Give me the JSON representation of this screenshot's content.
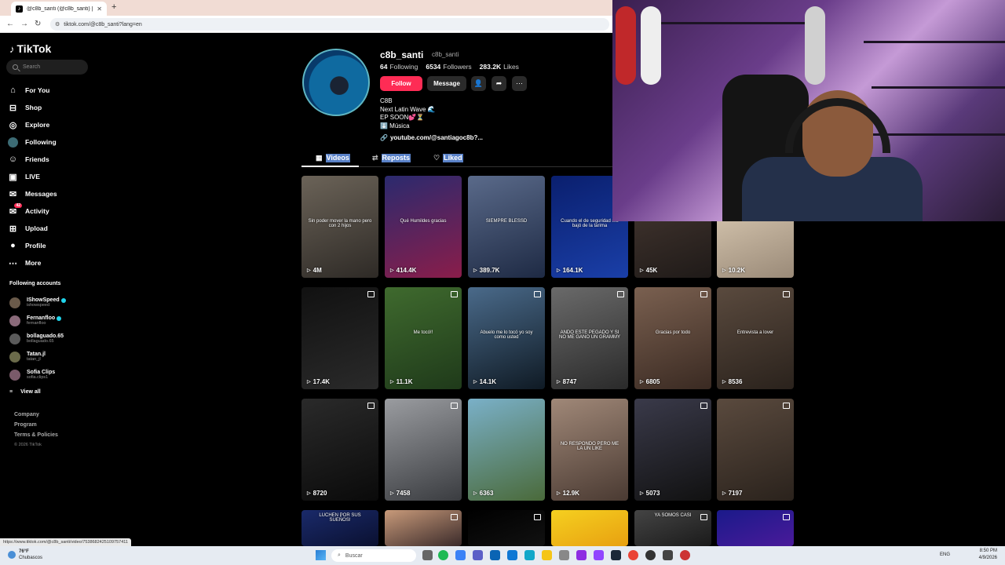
{
  "browser": {
    "tab_title": "@c8b_santi (@c8b_santi) | TikTok",
    "url": "tiktok.com/@c8b_santi?lang=en",
    "status_url": "https://www.tiktok.com/@c8b_santi/video/7538682425109757411"
  },
  "sidebar": {
    "logo": "TikTok",
    "search_placeholder": "Search",
    "nav": [
      {
        "label": "For You",
        "icon": "home-icon"
      },
      {
        "label": "Shop",
        "icon": "shop-icon"
      },
      {
        "label": "Explore",
        "icon": "compass-icon"
      },
      {
        "label": "Following",
        "icon": "avatar-icon"
      },
      {
        "label": "Friends",
        "icon": "friends-icon"
      },
      {
        "label": "LIVE",
        "icon": "live-icon"
      },
      {
        "label": "Messages",
        "icon": "messages-icon"
      },
      {
        "label": "Activity",
        "icon": "activity-icon",
        "badge": "42"
      },
      {
        "label": "Upload",
        "icon": "upload-icon"
      },
      {
        "label": "Profile",
        "icon": "profile-icon"
      },
      {
        "label": "More",
        "icon": "more-icon"
      }
    ],
    "following_title": "Following accounts",
    "following": [
      {
        "name": "IShowSpeed",
        "handle": "ishowspeed",
        "verified": true
      },
      {
        "name": "Fernanfloo",
        "handle": "fernanfloo",
        "verified": true
      },
      {
        "name": "bollaguado.65",
        "handle": "bollaguado.65",
        "verified": false
      },
      {
        "name": "Tatan.jl",
        "handle": "tatan_jl",
        "verified": false
      },
      {
        "name": "Sofia Clips",
        "handle": "sofia.clips1",
        "verified": false
      }
    ],
    "view_all": "View all",
    "footer": [
      "Company",
      "Program",
      "Terms & Policies"
    ],
    "copyright": "© 2026 TikTok"
  },
  "profile": {
    "username": "c8b_santi",
    "handle": "c8b_santi",
    "following_count": "64",
    "following_label": "Following",
    "followers_count": "6534",
    "followers_label": "Followers",
    "likes_count": "283.2K",
    "likes_label": "Likes",
    "follow_btn": "Follow",
    "message_btn": "Message",
    "bio": [
      "C8B",
      "Next Latin Wave 🌊",
      "EP SOON💕⏳",
      "⬇️ Música"
    ],
    "link": "youtube.com/@santiagoc8b?..."
  },
  "tabs": {
    "videos": "Videos",
    "reposts": "Reposts",
    "liked": "Liked"
  },
  "videos": [
    {
      "views": "4M",
      "caption": "Sin poder mover la mano pero con 2 hijos",
      "multi": false
    },
    {
      "views": "414.4K",
      "caption": "Qué Humildes gracias",
      "multi": false
    },
    {
      "views": "389.7K",
      "caption": "SIEMPRE BLESSD",
      "multi": false
    },
    {
      "views": "164.1K",
      "caption": "Cuando el de seguridad me bajó de la tarima",
      "multi": false
    },
    {
      "views": "45K",
      "caption": "",
      "multi": false
    },
    {
      "views": "10.2K",
      "caption": "",
      "multi": false
    },
    {
      "views": "17.4K",
      "caption": "",
      "multi": true
    },
    {
      "views": "11.1K",
      "caption": "Me tocó!!",
      "multi": true
    },
    {
      "views": "14.1K",
      "caption": "Abuelo me lo tocó yo soy como usted",
      "multi": true
    },
    {
      "views": "8747",
      "caption": "ANDO ESTE PEGADO Y SI NO ME GANO UN GRAMMY",
      "multi": true
    },
    {
      "views": "6805",
      "caption": "Gracias por todo",
      "multi": true
    },
    {
      "views": "8536",
      "caption": "Entrevista a lover",
      "multi": true
    },
    {
      "views": "8720",
      "caption": "",
      "multi": true
    },
    {
      "views": "7458",
      "caption": "",
      "multi": true
    },
    {
      "views": "6363",
      "caption": "",
      "multi": false
    },
    {
      "views": "12.9K",
      "caption": "NO RESPONDO PERO ME LA UN LIKE",
      "multi": false
    },
    {
      "views": "5073",
      "caption": "",
      "multi": true
    },
    {
      "views": "7197",
      "caption": "",
      "multi": true
    },
    {
      "views": "",
      "caption": "LUCHEN POR SUS SUEÑOS!",
      "multi": false
    },
    {
      "views": "",
      "caption": "",
      "multi": true
    },
    {
      "views": "",
      "caption": "",
      "multi": true
    },
    {
      "views": "",
      "caption": "",
      "multi": false
    },
    {
      "views": "",
      "caption": "YA SOMOS CASI",
      "multi": true
    },
    {
      "views": "",
      "caption": "",
      "multi": true
    }
  ],
  "taskbar": {
    "weather_temp": "76°F",
    "weather_desc": "Chubascos",
    "search": "Buscar",
    "lang": "ENG",
    "time": "8:50 PM",
    "date": "4/9/2026"
  }
}
